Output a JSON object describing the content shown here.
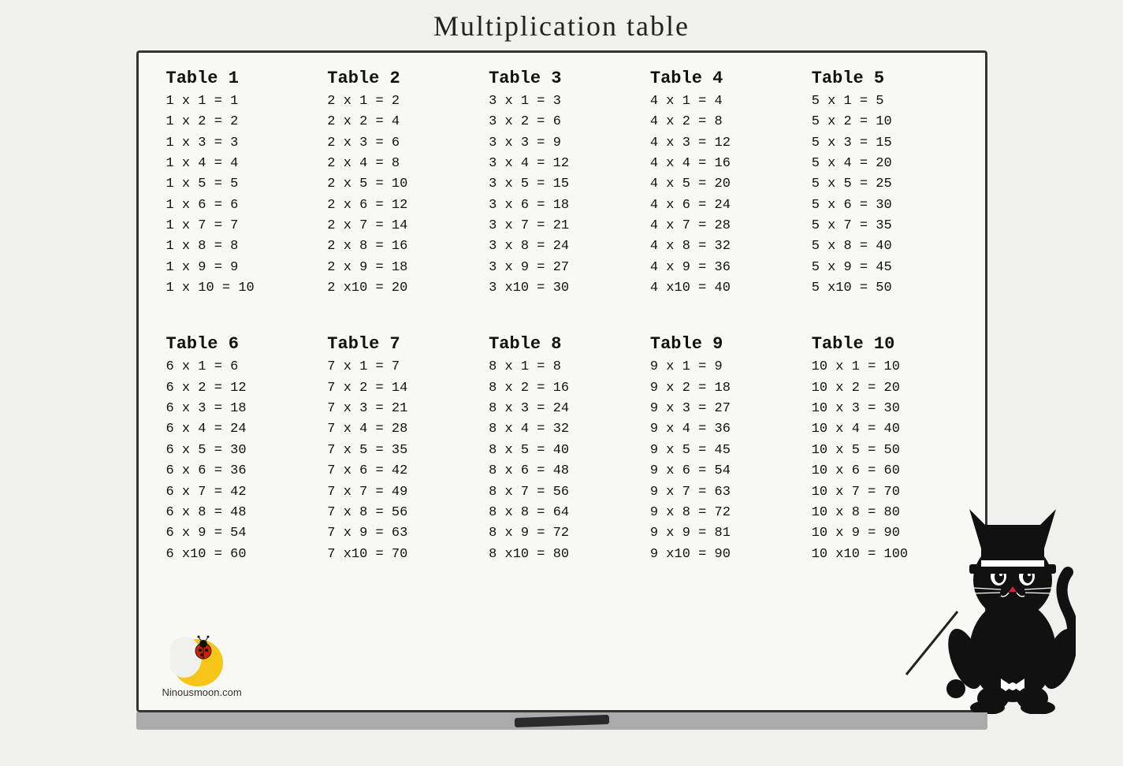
{
  "page": {
    "title": "Multiplication table",
    "background_color": "#f0f0ec"
  },
  "blackboard": {
    "border_color": "#333",
    "background": "#f8f8f5"
  },
  "tables": [
    {
      "header": "Table  1",
      "rows": [
        "1 x  1  = 1",
        "1 x  2  = 2",
        "1 x  3  = 3",
        "1 x  4  = 4",
        "1 x  5  = 5",
        "1 x  6  = 6",
        "1 x  7  = 7",
        "1 x  8  = 8",
        "1 x  9  = 9",
        "1 x 10 = 10"
      ]
    },
    {
      "header": "Table  2",
      "rows": [
        "2 x  1 = 2",
        "2 x  2 = 4",
        "2 x  3 = 6",
        "2 x  4 = 8",
        "2 x  5 = 10",
        "2 x  6 = 12",
        "2 x  7 = 14",
        "2 x  8 = 16",
        "2 x  9 = 18",
        "2 x10 = 20"
      ]
    },
    {
      "header": "Table  3",
      "rows": [
        "3 x  1 = 3",
        "3 x  2 = 6",
        "3 x  3 = 9",
        "3 x  4 = 12",
        "3 x  5 = 15",
        "3 x  6 = 18",
        "3 x  7 = 21",
        "3 x  8 = 24",
        "3 x  9 = 27",
        "3 x10 = 30"
      ]
    },
    {
      "header": "Table  4",
      "rows": [
        "4 x  1 = 4",
        "4 x  2 = 8",
        "4 x  3 = 12",
        "4 x  4 = 16",
        "4 x  5 = 20",
        "4 x  6 = 24",
        "4 x  7 = 28",
        "4 x  8 = 32",
        "4 x  9 = 36",
        "4 x10 = 40"
      ]
    },
    {
      "header": "Table  5",
      "rows": [
        "5 x  1 = 5",
        "5 x  2 = 10",
        "5 x  3 = 15",
        "5 x  4 = 20",
        "5 x  5 = 25",
        "5 x  6 = 30",
        "5 x  7 = 35",
        "5 x  8 = 40",
        "5 x  9 = 45",
        "5 x10 = 50"
      ]
    },
    {
      "header": "Table  6",
      "rows": [
        "6 x  1 = 6",
        "6 x  2 = 12",
        "6 x  3 = 18",
        "6 x  4 = 24",
        "6 x  5 = 30",
        "6 x  6 = 36",
        "6 x  7 = 42",
        "6 x  8 = 48",
        "6 x  9 = 54",
        "6 x10 = 60"
      ]
    },
    {
      "header": "Table  7",
      "rows": [
        "7 x  1 = 7",
        "7 x  2 = 14",
        "7 x  3 = 21",
        "7 x  4 = 28",
        "7 x  5 = 35",
        "7 x  6 = 42",
        "7 x  7 = 49",
        "7 x  8 = 56",
        "7 x  9 = 63",
        "7 x10 = 70"
      ]
    },
    {
      "header": "Table  8",
      "rows": [
        "8 x  1 = 8",
        "8 x  2 = 16",
        "8 x  3 = 24",
        "8 x  4 = 32",
        "8 x  5 = 40",
        "8 x  6 = 48",
        "8 x  7 = 56",
        "8 x  8 = 64",
        "8 x  9 = 72",
        "8 x10 = 80"
      ]
    },
    {
      "header": "Table  9",
      "rows": [
        "9 x  1 = 9",
        "9 x  2 = 18",
        "9 x  3 = 27",
        "9 x  4 = 36",
        "9 x  5 = 45",
        "9 x  6 = 54",
        "9 x  7 = 63",
        "9 x  8 = 72",
        "9 x  9 = 81",
        "9 x10 = 90"
      ]
    },
    {
      "header": "Table 10",
      "rows": [
        "10 x  1 = 10",
        "10 x  2 = 20",
        "10 x  3 = 30",
        "10 x  4 = 40",
        "10 x  5 = 50",
        "10 x  6 = 60",
        "10 x  7 = 70",
        "10 x  8 = 80",
        "10 x  9 = 90",
        "10 x10 = 100"
      ]
    }
  ],
  "logo": {
    "site": "Ninousmoon.com"
  }
}
